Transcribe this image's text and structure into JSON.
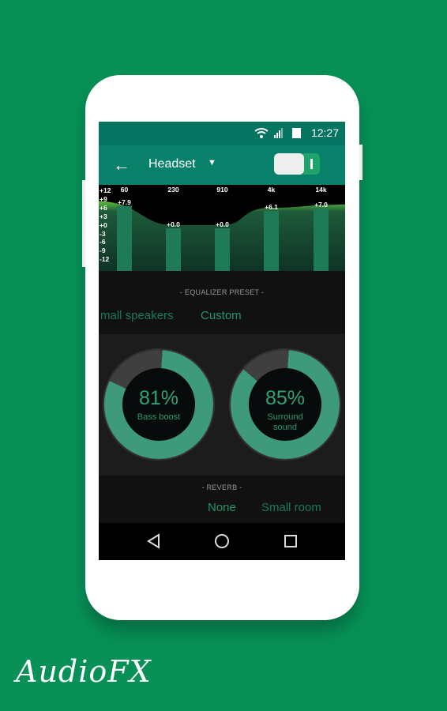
{
  "status_bar": {
    "time": "12:27",
    "icons": [
      "wifi-icon",
      "signal-icon",
      "battery-icon"
    ]
  },
  "toolbar": {
    "back_icon": "arrow-left-icon",
    "title": "Headset",
    "dropdown_icon": "caret-down-icon",
    "toggle_on": true
  },
  "equalizer": {
    "scale": [
      "+12",
      "+9",
      "+6",
      "+3",
      "+0",
      "-3",
      "-6",
      "-9",
      "-12"
    ],
    "bands": [
      {
        "freq": "60",
        "value": "+7.9",
        "db": 7.9
      },
      {
        "freq": "230",
        "value": "+0.0",
        "db": 0
      },
      {
        "freq": "910",
        "value": "+0.0",
        "db": 0
      },
      {
        "freq": "4k",
        "value": "+6.1",
        "db": 6.1
      },
      {
        "freq": "14k",
        "value": "+7.0",
        "db": 7.0
      }
    ]
  },
  "preset": {
    "caption": "- EQUALIZER PRESET -",
    "options": [
      "mall speakers",
      "Custom"
    ],
    "selected": "Custom"
  },
  "effects": [
    {
      "value": "81%",
      "fraction": 0.81,
      "label": "Bass boost"
    },
    {
      "value": "85%",
      "fraction": 0.85,
      "label": "Surround sound"
    }
  ],
  "reverb": {
    "caption": "- REVERB -",
    "options": [
      "None",
      "Small room"
    ],
    "selected": "None"
  },
  "navbar": {
    "icons": [
      "back-triangle-icon",
      "home-circle-icon",
      "recents-square-icon"
    ]
  },
  "colors": {
    "background": "#079157",
    "accent": "#3e9a7a",
    "toolbar": "#08806a"
  },
  "brand": "AudioFX"
}
